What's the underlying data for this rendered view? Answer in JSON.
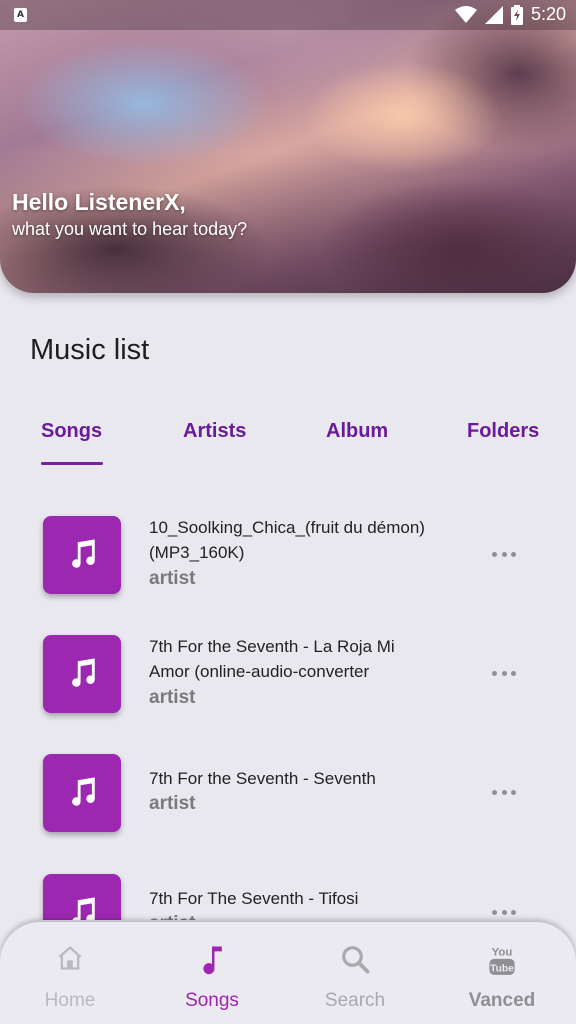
{
  "colors": {
    "accent": "#9c27b0",
    "tab_text": "#6a1b9a",
    "background": "#e9e8ef",
    "nav_active": "#9c27b0",
    "nav_inactive": "#a8a8a8"
  },
  "status_bar": {
    "time": "5:20",
    "icons": [
      "app-notification-icon",
      "wifi-icon",
      "signal-icon",
      "battery-charging-icon"
    ]
  },
  "header": {
    "greeting": "Hello ListenerX,",
    "subtitle": "what you want to hear today?"
  },
  "main": {
    "title": "Music list",
    "tabs": [
      {
        "label": "Songs",
        "active": true
      },
      {
        "label": "Artists",
        "active": false
      },
      {
        "label": "Album",
        "active": false
      },
      {
        "label": "Folders",
        "active": false
      }
    ],
    "songs": [
      {
        "title": "10_Soolking_Chica_(fruit du démon)(MP3_160K)",
        "artist": "artist",
        "icon": "music-note-icon"
      },
      {
        "title": "7th For the Seventh - La Roja Mi Amor (online-audio-converter",
        "artist": "artist",
        "icon": "music-note-icon"
      },
      {
        "title": "7th For the Seventh - Seventh",
        "artist": "artist",
        "icon": "music-note-icon"
      },
      {
        "title": "7th For The Seventh - Tifosi",
        "artist": "artist",
        "icon": "music-note-icon"
      }
    ]
  },
  "bottom_nav": {
    "items": [
      {
        "label": "Home",
        "icon": "home-icon",
        "active": false
      },
      {
        "label": "Songs",
        "icon": "music-note-icon",
        "active": true
      },
      {
        "label": "Search",
        "icon": "search-icon",
        "active": false
      },
      {
        "label": "Vanced",
        "icon": "youtube-icon",
        "active": false
      }
    ]
  }
}
